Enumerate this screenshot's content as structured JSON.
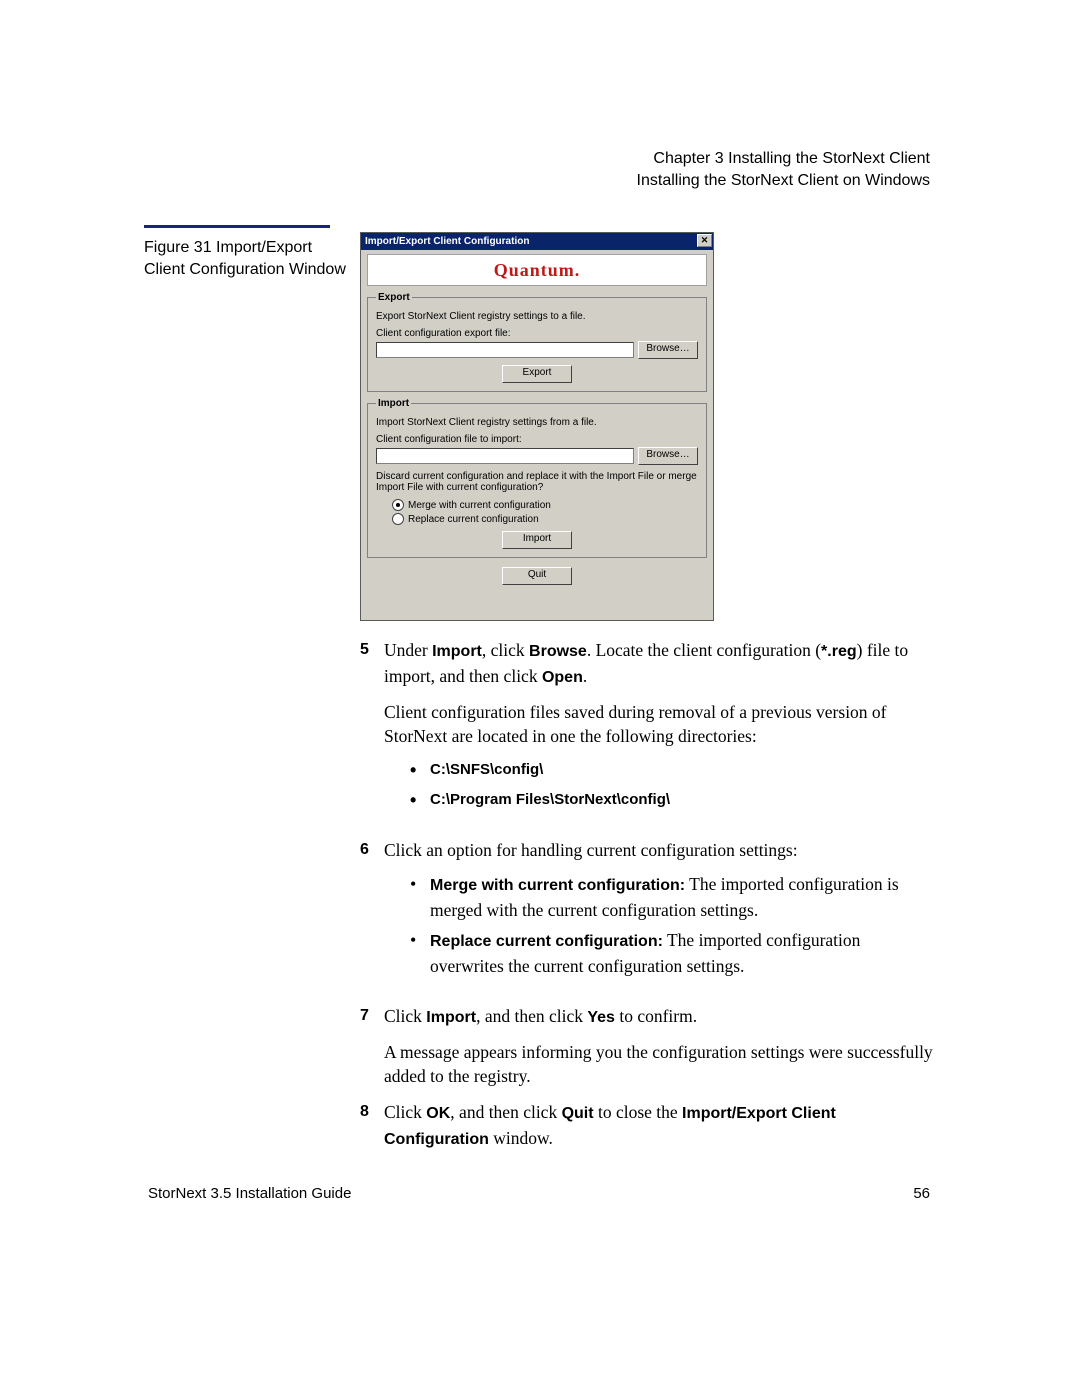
{
  "header": {
    "line1": "Chapter 3  Installing the StorNext Client",
    "line2": "Installing the StorNext Client on Windows"
  },
  "figure_caption": "Figure 31  Import/Export Client Configuration Window",
  "dialog": {
    "title": "Import/Export Client Configuration",
    "close": "✕",
    "brand": "Quantum.",
    "export": {
      "legend": "Export",
      "desc": "Export StorNext Client registry settings to a file.",
      "label": "Client configuration export file:",
      "browse": "Browse…",
      "button": "Export"
    },
    "import": {
      "legend": "Import",
      "desc": "Import StorNext Client registry settings from a file.",
      "label": "Client configuration file to import:",
      "browse": "Browse…",
      "question": "Discard current configuration and replace it with the Import File or merge Import File with current configuration?",
      "opt_merge": "Merge with current configuration",
      "opt_replace": "Replace current configuration",
      "button": "Import"
    },
    "quit": "Quit"
  },
  "steps": {
    "s5_a": "Under ",
    "s5_b": "Import",
    "s5_c": ", click ",
    "s5_d": "Browse",
    "s5_e": ". Locate the client configuration (",
    "s5_f": "*.reg",
    "s5_g": ") file to import, and then click ",
    "s5_h": "Open",
    "s5_i": ".",
    "s5_p2": "Client configuration files saved during removal of a previous version of StorNext are located in one the following directories:",
    "dir1": "C:\\SNFS\\config\\",
    "dir2": "C:\\Program Files\\StorNext\\config\\",
    "s6": "Click an option for handling current configuration settings:",
    "s6_m1": "Merge with current configuration:",
    "s6_m2": " The imported configuration is merged with the current configuration settings.",
    "s6_r1": "Replace current configuration:",
    "s6_r2": " The imported configuration overwrites the current configuration settings.",
    "s7_a": "Click ",
    "s7_b": "Import",
    "s7_c": ", and then click ",
    "s7_d": "Yes",
    "s7_e": " to confirm.",
    "s7_p2": "A message appears informing you the configuration settings were successfully added to the registry.",
    "s8_a": "Click ",
    "s8_b": "OK",
    "s8_c": ", and then click ",
    "s8_d": "Quit",
    "s8_e": " to close the ",
    "s8_f": "Import/Export Client Configuration",
    "s8_g": " window."
  },
  "footer": {
    "guide": "StorNext 3.5 Installation Guide",
    "page": "56"
  }
}
